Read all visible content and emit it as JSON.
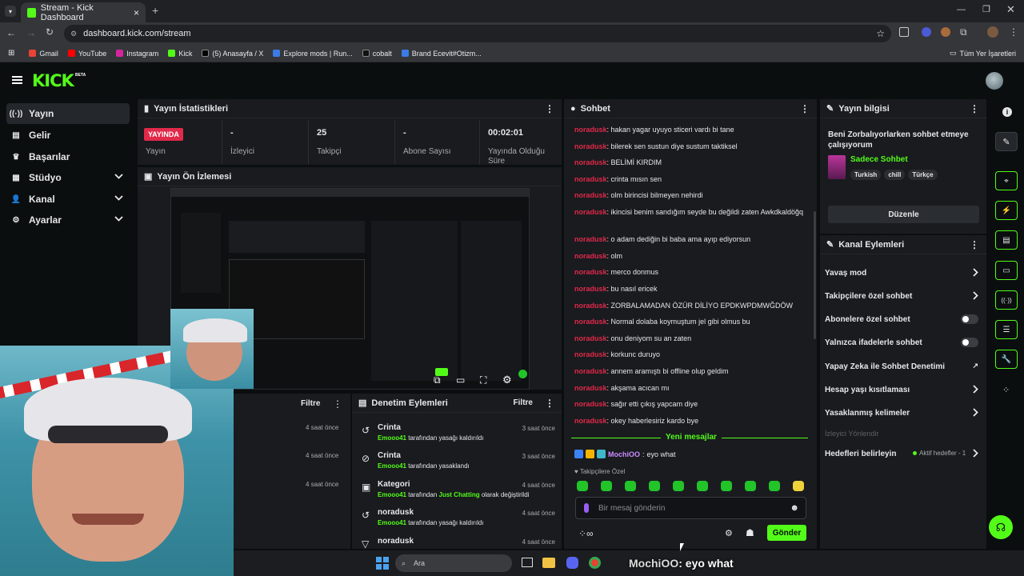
{
  "browser": {
    "tab_title": "Stream - Kick Dashboard",
    "url": "dashboard.kick.com/stream",
    "bookmarks": [
      "Gmail",
      "YouTube",
      "Instagram",
      "Kick",
      "(5) Anasayfa / X",
      "Explore mods | Run...",
      "cobalt",
      "Brand Ecevit#Otizm..."
    ],
    "all_bookmarks": "Tüm Yer İşaretleri"
  },
  "brand": {
    "logo": "KICK",
    "beta": "BETA"
  },
  "sidebar": {
    "items": [
      {
        "label": "Yayın",
        "icon": "broadcast-icon"
      },
      {
        "label": "Gelir",
        "icon": "money-icon"
      },
      {
        "label": "Başarılar",
        "icon": "trophy-icon"
      },
      {
        "label": "Stüdyo",
        "icon": "studio-icon"
      },
      {
        "label": "Kanal",
        "icon": "users-icon"
      },
      {
        "label": "Ayarlar",
        "icon": "gear-icon"
      }
    ]
  },
  "stats": {
    "title": "Yayın İstatistikleri",
    "live_badge": "YAYINDA",
    "live_label": "Yayın",
    "viewers_value": "-",
    "viewers_label": "İzleyici",
    "followers_value": "25",
    "followers_label": "Takipçi",
    "subs_value": "-",
    "subs_label": "Abone Sayısı",
    "duration_value": "00:02:01",
    "duration_label": "Yayında Olduğu Süre"
  },
  "preview": {
    "title": "Yayın Ön İzlemesi"
  },
  "activity": {
    "filter": "Filtre",
    "times": [
      "4 saat önce",
      "4 saat önce",
      "4 saat önce"
    ]
  },
  "moderation": {
    "title": "Denetim Eylemleri",
    "filter": "Filtre",
    "events": [
      {
        "title": "Crinta",
        "by": "Emooo41",
        "text": " tarafından yasağı kaldırıldı",
        "extra": "",
        "extra_post": "",
        "time": "3 saat önce"
      },
      {
        "title": "Crinta",
        "by": "Emooo41",
        "text": " tarafından yasaklandı",
        "extra": "",
        "extra_post": "",
        "time": "3 saat önce"
      },
      {
        "title": "Kategori",
        "by": "Emooo41",
        "text": " tarafından ",
        "extra": "Just Chatting",
        "extra_post": " olarak değiştirildi",
        "time": "4 saat önce"
      },
      {
        "title": "noradusk",
        "by": "Emooo41",
        "text": " tarafından yasağı kaldırıldı",
        "extra": "",
        "extra_post": "",
        "time": "4 saat önce"
      },
      {
        "title": "noradusk",
        "by": "",
        "text": "",
        "extra": "",
        "extra_post": "",
        "time": "4 saat önce"
      }
    ]
  },
  "chat": {
    "title": "Sohbet",
    "messages": [
      {
        "user": "noradusk",
        "text": "hakan yagar uyuyo sticeri vardı bi tane"
      },
      {
        "user": "noradusk",
        "text": "bilerek sen sustun diye sustum taktiksel"
      },
      {
        "user": "noradusk",
        "text": "BELİMİ KIRDIM"
      },
      {
        "user": "noradusk",
        "text": "crinta mısın sen"
      },
      {
        "user": "noradusk",
        "text": "olm birincisi bilmeyen nehirdi"
      },
      {
        "user": "noradusk",
        "text": "ikincisi benim sandığım seyde bu değildi zaten Awkdkaldöğq"
      },
      {
        "user": "noradusk",
        "text": "o adam dediğin bi baba ama ayıp ediyorsun"
      },
      {
        "user": "noradusk",
        "text": "olm"
      },
      {
        "user": "noradusk",
        "text": "merco donmus"
      },
      {
        "user": "noradusk",
        "text": "bu nasıl ericek"
      },
      {
        "user": "noradusk",
        "text": "ZORBALAMADAN ÖZÜR DİLİYO EPDKWPDMWĞDÖW"
      },
      {
        "user": "noradusk",
        "text": "Normal dolaba koymuştum jel gibi olmus bu"
      },
      {
        "user": "noradusk",
        "text": "onu deniyom su an zaten"
      },
      {
        "user": "noradusk",
        "text": "korkunc duruyo"
      },
      {
        "user": "noradusk",
        "text": "annem aramıştı bi offline olup geldim"
      },
      {
        "user": "noradusk",
        "text": "akşama acıcan mı"
      },
      {
        "user": "noradusk",
        "text": "sağır etti çıkış yapcam diye"
      },
      {
        "user": "noradusk",
        "text": "okey haberlesiriz kardo bye"
      }
    ],
    "new_messages": "Yeni mesajlar",
    "last_user": "MochiOO",
    "last_text": " eyo what",
    "followers_only": "Takipçilere Özel",
    "input_placeholder": "Bir mesaj gönderin",
    "send": "Gönder"
  },
  "stream_info": {
    "title": "Yayın bilgisi",
    "stream_title": "Beni Zorbalıyorlarken sohbet etmeye çalışıyorum",
    "category": "Sadece Sohbet",
    "tags": [
      "Turkish",
      "chill",
      "Türkçe"
    ],
    "edit": "Düzenle"
  },
  "channel_actions": {
    "title": "Kanal Eylemleri",
    "slow_mode": "Yavaş mod",
    "followers_chat": "Takipçilere özel sohbet",
    "subs_chat": "Abonelere özel sohbet",
    "emote_chat": "Yalnızca ifadelerle sohbet",
    "ai_moderation": "Yapay Zeka ile Sohbet Denetimi",
    "age_limit": "Hesap yaşı kısıtlaması",
    "banned_words": "Yasaklanmış kelimeler",
    "raid": "İzleyici Yönlendir",
    "goals": "Hedefleri belirleyin",
    "goals_status": "Aktif hedefler - 1"
  },
  "taskbar": {
    "search": "Ara",
    "overlay_user": "MochiOO",
    "overlay_text": ": eyo what"
  },
  "colors": {
    "accent": "#53fc18",
    "live": "#e1294a",
    "username": "#e1294a",
    "panel": "#191b1f",
    "bg": "#0b0e0f"
  }
}
